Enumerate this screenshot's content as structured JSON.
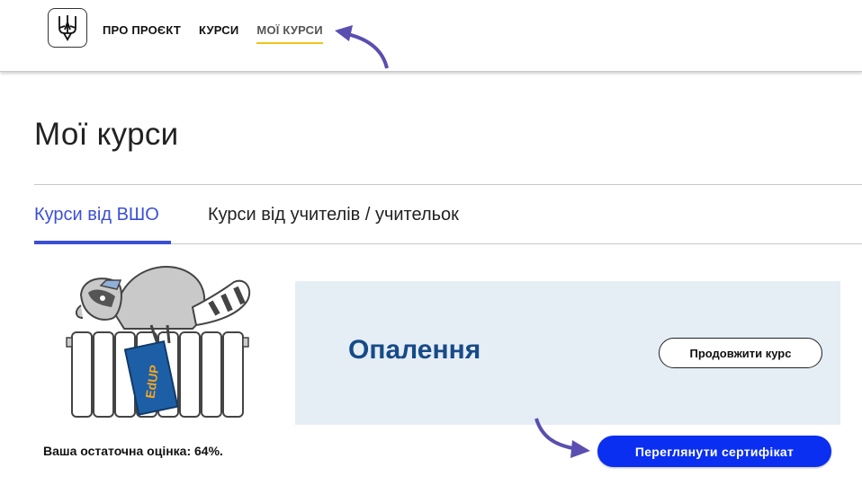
{
  "header": {
    "logo_icon": "trident-icon",
    "nav": [
      {
        "label": "ПРО ПРОЄКТ",
        "active": false
      },
      {
        "label": "КУРСИ",
        "active": false
      },
      {
        "label": "МОЇ КУРСИ",
        "active": true
      }
    ]
  },
  "page": {
    "title": "Мої курси"
  },
  "tabs": [
    {
      "label": "Курси від ВШО",
      "active": true
    },
    {
      "label": "Курси від учителів / учительок",
      "active": false
    }
  ],
  "course": {
    "image_icon": "raccoon-on-radiator-illustration",
    "image_logo_text": "EdUP",
    "title": "Опалення",
    "continue_label": "Продовжити курс",
    "grade_text": "Ваша остаточна оцінка: 64%.",
    "grade_percent": 64,
    "certificate_label": "Переглянути сертифікат"
  },
  "colors": {
    "accent_blue": "#3b4fd6",
    "button_blue": "#0a2ff0",
    "nav_underline": "#f0c419",
    "course_panel": "#e5edf5",
    "course_title": "#174a87",
    "annotation_arrow": "#5a4fb0"
  }
}
